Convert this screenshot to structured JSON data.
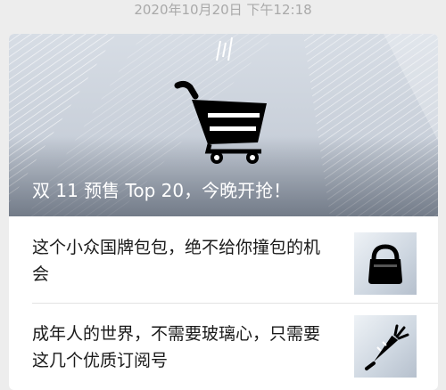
{
  "timestamp": "2020年10月20日 下午12:18",
  "hero": {
    "title": "双 11 预售 Top 20，今晚开抢！",
    "icon": "shopping-cart-icon"
  },
  "articles": [
    {
      "title": "这个小众国牌包包，绝不给你撞包的机会",
      "icon": "handbag-icon"
    },
    {
      "title": "成年人的世界，不需要玻璃心，只需要这几个优质订阅号",
      "icon": "carrot-icon"
    }
  ]
}
